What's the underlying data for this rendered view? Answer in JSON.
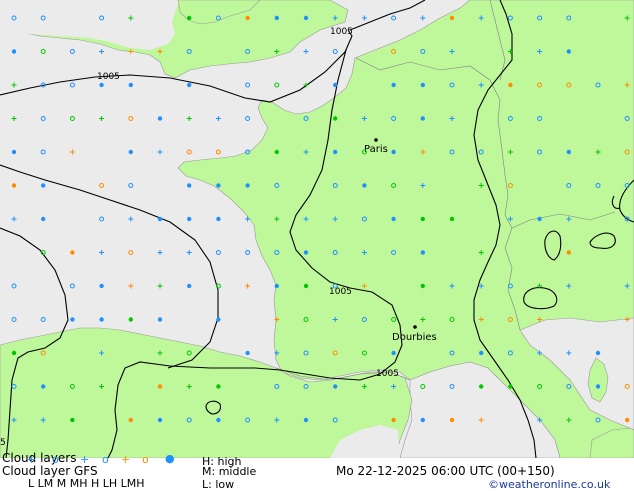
{
  "map": {
    "cities": [
      {
        "name": "Paris"
      },
      {
        "name": "Dourbies"
      }
    ],
    "isobar_labels": [
      "1005",
      "1005",
      "1005",
      "1005",
      "5"
    ],
    "colors": {
      "sea": "#ebebeb",
      "land": "#bff79b",
      "isobar": "#000000",
      "high_cloud": "#1e90ff",
      "middle_cloud": "#00c800",
      "low_cloud": "#ff8c00",
      "border": "#808080"
    }
  },
  "footer": {
    "title": "Cloud layers",
    "model_label": "Cloud layer  GFS",
    "legend_letters": "L   LM   M  MH  H   LH  LMH",
    "high_label": "H: high",
    "middle_label": "M: middle",
    "low_label": "L: low",
    "datetime": "Mo 22-12-2025 06:00 UTC (00+150)",
    "credit": "©weatheronline.co.uk"
  }
}
